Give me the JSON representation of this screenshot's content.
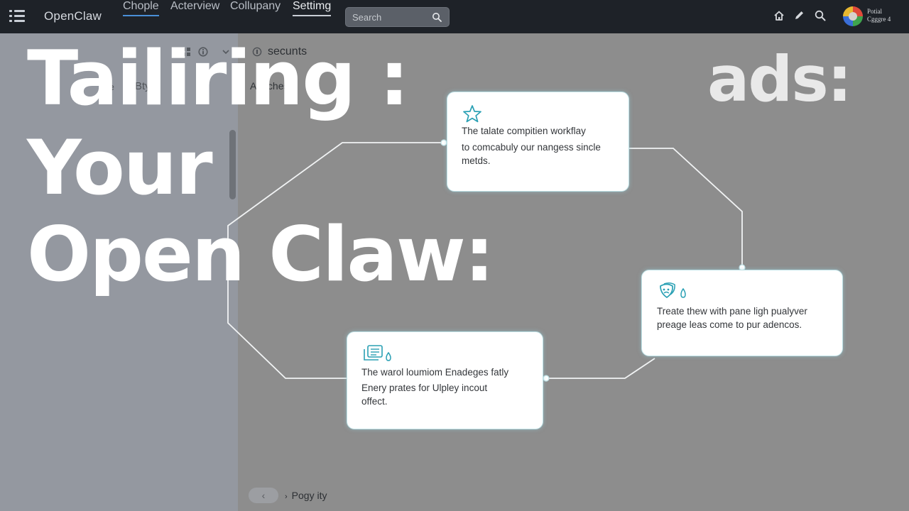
{
  "brand": "OpenClaw",
  "nav": {
    "items": [
      "Chople",
      "Acterview",
      "Collupany",
      "Settimg"
    ]
  },
  "search": {
    "placeholder": "Search"
  },
  "user": {
    "line1": "Potial",
    "line2": "Cgggre 4"
  },
  "sidebar": {
    "row_items": [
      "te",
      "Bty",
      "W"
    ]
  },
  "main": {
    "title": "secunts",
    "subtab": "Attechesty"
  },
  "overlay": {
    "line1": "Tailiring :",
    "line2": "Your",
    "line3": "Open Claw:",
    "side": "ads:"
  },
  "cards": [
    {
      "icon": "star-icon",
      "lines": [
        "The talate compitien workflay",
        "to comcabuly our nangess sincle",
        "metds."
      ]
    },
    {
      "icon": "masks-icon",
      "lines": [
        "Treate thew with pane ligh pualyver",
        "preage leas come to pur adencos."
      ]
    },
    {
      "icon": "document-icon",
      "lines": [
        "The warol loumiom Enadeges fatly",
        "Enery prates for Ulpley incout",
        "offect."
      ]
    }
  ],
  "footer": {
    "back_label": "‹",
    "link_label": "Pogy ity"
  },
  "colors": {
    "topbar": "#1e2228",
    "accent": "#2aa0b4",
    "card_border": "#bfe1e6"
  }
}
